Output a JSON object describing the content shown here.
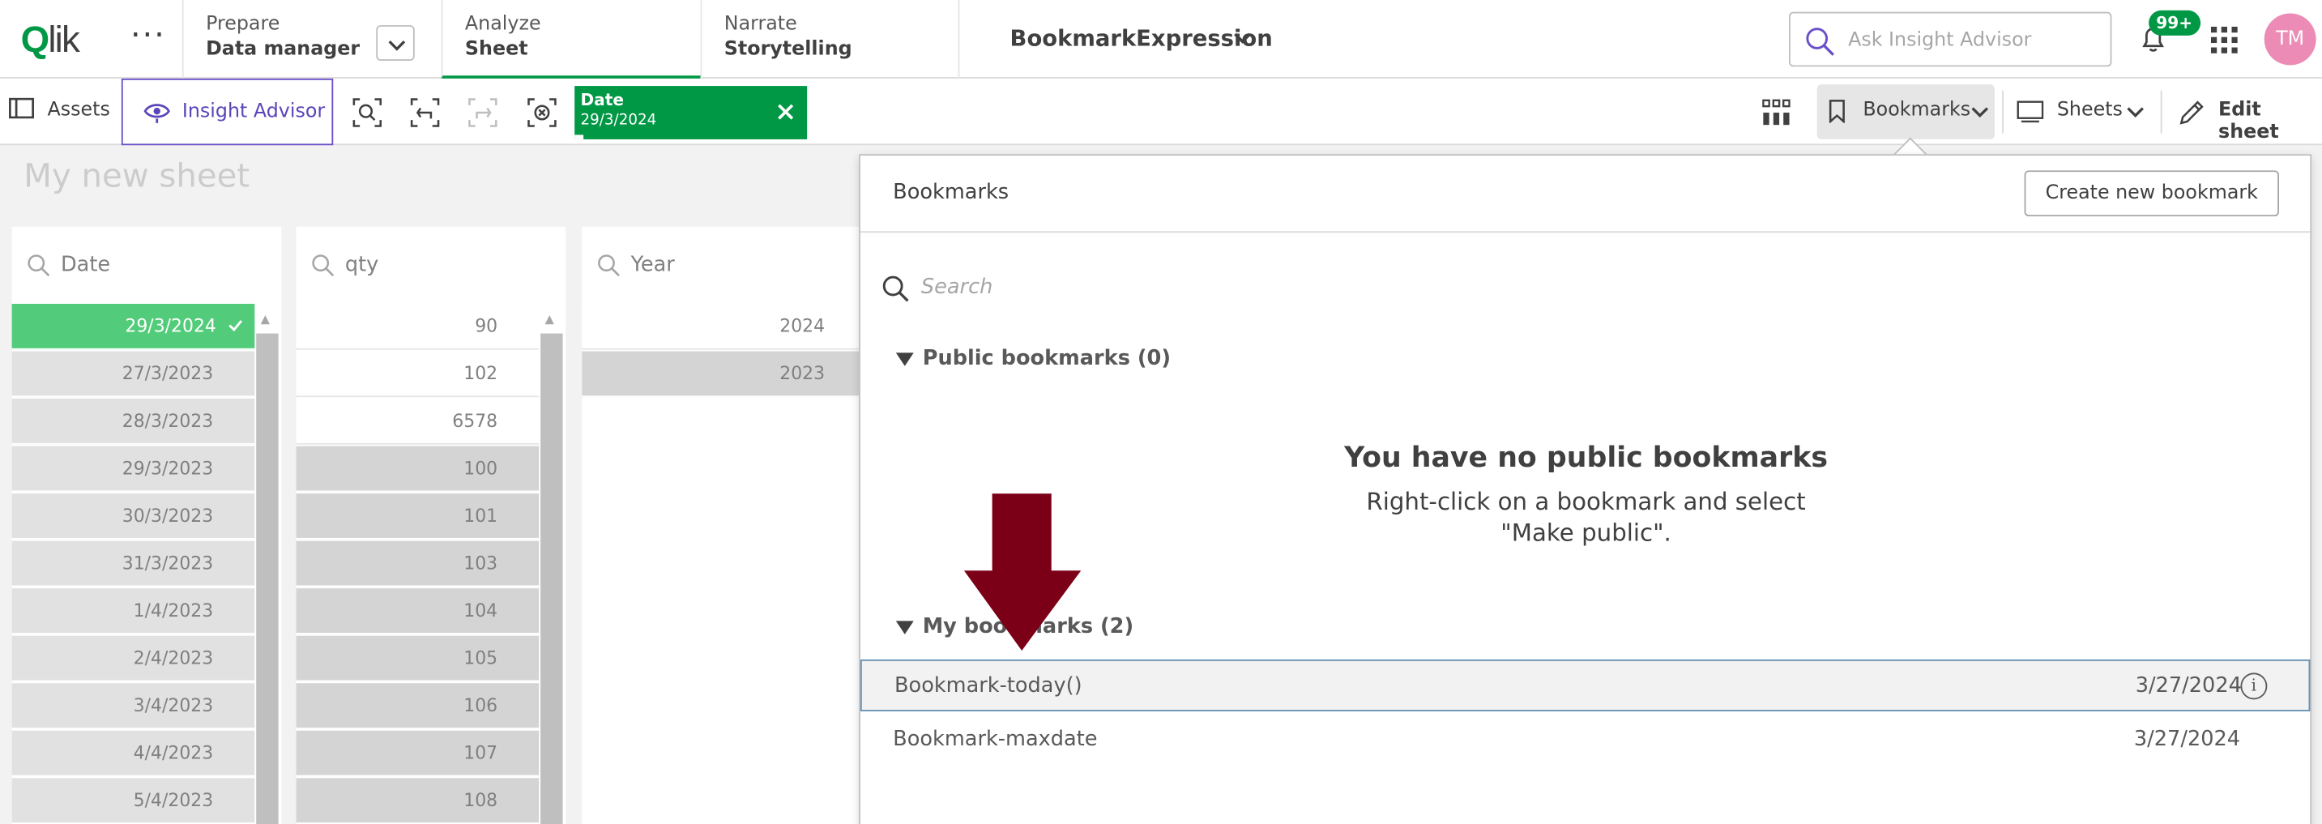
{
  "logo": {
    "text_q": "Q",
    "text_rest": "lik"
  },
  "menu_dots": "···",
  "nav": [
    {
      "small": "Prepare",
      "big": "Data manager"
    },
    {
      "small": "Analyze",
      "big": "Sheet"
    },
    {
      "small": "Narrate",
      "big": "Storytelling"
    }
  ],
  "app_title": "BookmarkExpression",
  "search": {
    "placeholder": "Ask Insight Advisor"
  },
  "notifications_badge": "99+",
  "avatar_initials": "TM",
  "toolbar": {
    "assets": "Assets",
    "insight_advisor": "Insight Advisor",
    "selection_field": "Date",
    "selection_value": "29/3/2024",
    "bookmarks": "Bookmarks",
    "sheets": "Sheets",
    "edit_sheet": "Edit sheet"
  },
  "sheet_title": "My new sheet",
  "listboxes": [
    {
      "title": "Date",
      "rows": [
        "29/3/2024",
        "27/3/2023",
        "28/3/2023",
        "29/3/2023",
        "30/3/2023",
        "31/3/2023",
        "1/4/2023",
        "2/4/2023",
        "3/4/2023",
        "4/4/2023",
        "5/4/2023"
      ]
    },
    {
      "title": "qty",
      "rows": [
        "90",
        "102",
        "6578",
        "100",
        "101",
        "103",
        "104",
        "105",
        "106",
        "107",
        "108"
      ]
    },
    {
      "title": "Year",
      "rows": [
        "2024",
        "2023"
      ]
    }
  ],
  "bookmarks_panel": {
    "title": "Bookmarks",
    "create_button": "Create new bookmark",
    "search_placeholder": "Search",
    "public_section": "Public bookmarks (0)",
    "empty_heading": "You have no public bookmarks",
    "empty_text": "Right-click on a bookmark and select \"Make public\".",
    "my_section": "My bookmarks (2)",
    "items": [
      {
        "name": "Bookmark-today()",
        "date": "3/27/2024"
      },
      {
        "name": "Bookmark-maxdate",
        "date": "3/27/2024"
      }
    ]
  },
  "colors": {
    "brand_green": "#009845",
    "selected": "#52cc7a",
    "insight_purple": "#6a4fc9",
    "arrow": "#7b0017"
  }
}
